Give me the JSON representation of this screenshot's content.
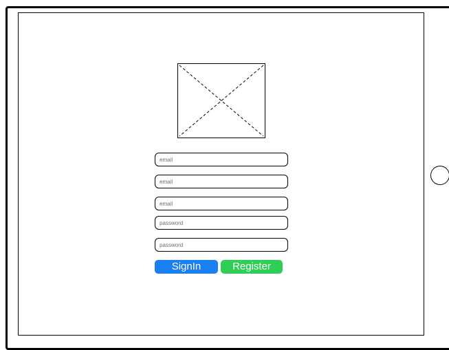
{
  "logo": {
    "icon": "image-placeholder-icon"
  },
  "form": {
    "fields": [
      {
        "placeholder": "email",
        "value": ""
      },
      {
        "placeholder": "email",
        "value": ""
      },
      {
        "placeholder": "email",
        "value": ""
      },
      {
        "placeholder": "password",
        "value": ""
      },
      {
        "placeholder": "password",
        "value": ""
      }
    ],
    "signin_label": "SignIn",
    "register_label": "Register"
  },
  "colors": {
    "signin": "#1a7ff0",
    "register": "#2fcf57"
  }
}
